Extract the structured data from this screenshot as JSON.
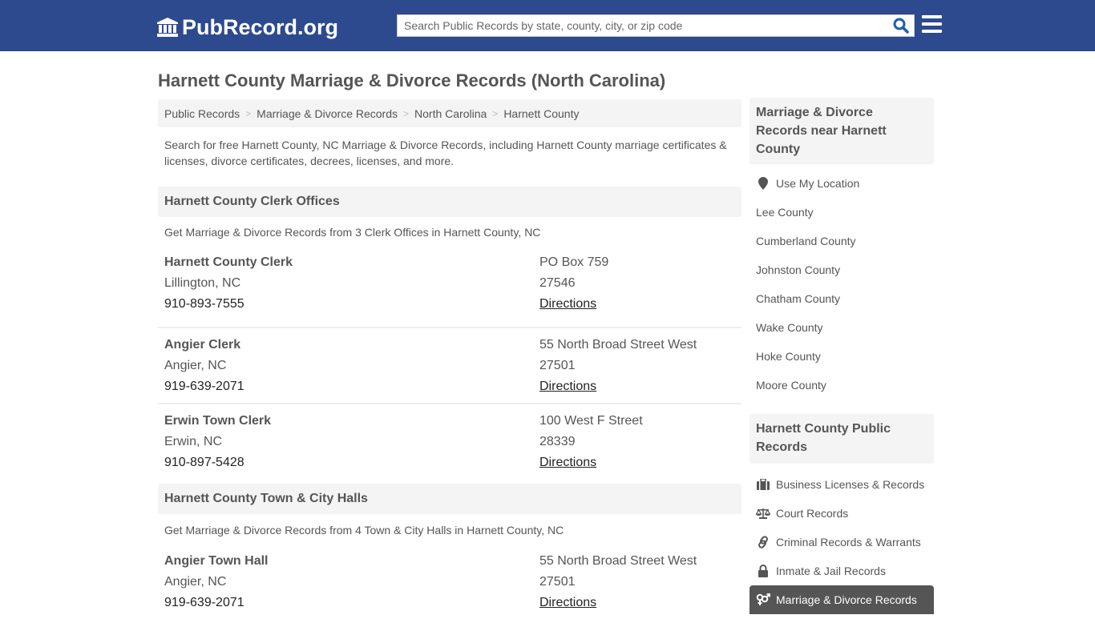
{
  "header": {
    "logo_text": "PubRecord.org",
    "search_placeholder": "Search Public Records by state, county, city, or zip code",
    "brand_color": "#2d4a8f"
  },
  "page": {
    "title": "Harnett County Marriage & Divorce Records (North Carolina)",
    "breadcrumb": [
      {
        "label": "Public Records"
      },
      {
        "label": "Marriage & Divorce Records"
      },
      {
        "label": "North Carolina"
      },
      {
        "label": "Harnett County"
      }
    ],
    "intro": "Search for free Harnett County, NC Marriage & Divorce Records, including Harnett County marriage certificates & licenses, divorce certificates, decrees, licenses, and more."
  },
  "sections": [
    {
      "title": "Harnett County Clerk Offices",
      "subtitle": "Get Marriage & Divorce Records from 3 Clerk Offices in Harnett County, NC",
      "entries": [
        {
          "name": "Harnett County Clerk",
          "city": "Lillington, NC",
          "phone": "910-893-7555",
          "address": "PO Box 759",
          "zip": "27546",
          "directions": "Directions"
        },
        {
          "name": "Angier Clerk",
          "city": "Angier, NC",
          "phone": "919-639-2071",
          "address": "55 North Broad Street West",
          "zip": "27501",
          "directions": "Directions"
        },
        {
          "name": "Erwin Town Clerk",
          "city": "Erwin, NC",
          "phone": "910-897-5428",
          "address": "100 West F Street",
          "zip": "28339",
          "directions": "Directions"
        }
      ]
    },
    {
      "title": "Harnett County Town & City Halls",
      "subtitle": "Get Marriage & Divorce Records from 4 Town & City Halls in Harnett County, NC",
      "entries": [
        {
          "name": "Angier Town Hall",
          "city": "Angier, NC",
          "phone": "919-639-2071",
          "address": "55 North Broad Street West",
          "zip": "27501",
          "directions": "Directions"
        }
      ]
    }
  ],
  "sidebar": {
    "nearby": {
      "title": "Marriage & Divorce Records near Harnett County",
      "use_location": "Use My Location",
      "counties": [
        "Lee County",
        "Cumberland County",
        "Johnston County",
        "Chatham County",
        "Wake County",
        "Hoke County",
        "Moore County"
      ]
    },
    "public_records": {
      "title": "Harnett County Public Records",
      "items": [
        {
          "label": "Business Licenses & Records",
          "icon": "briefcase-icon"
        },
        {
          "label": "Court Records",
          "icon": "scales-icon"
        },
        {
          "label": "Criminal Records & Warrants",
          "icon": "link-icon"
        },
        {
          "label": "Inmate & Jail Records",
          "icon": "lock-icon"
        },
        {
          "label": "Marriage & Divorce Records",
          "icon": "genders-icon",
          "active": true
        }
      ]
    }
  }
}
